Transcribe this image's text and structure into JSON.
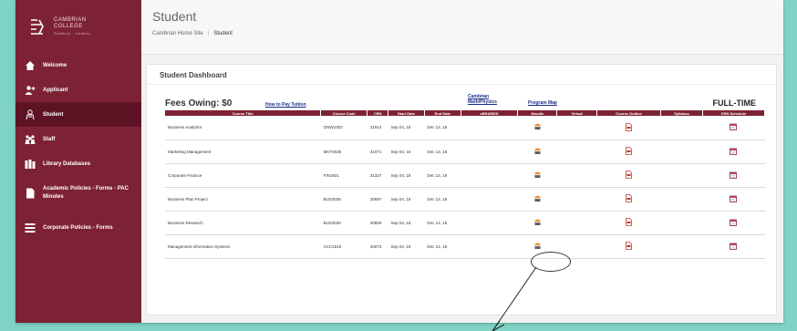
{
  "sidebar": {
    "logo": {
      "line1": "CAMBRIAN",
      "line2": "COLLEGE",
      "sub": "Sudbury · Ontario"
    },
    "items": [
      {
        "label": "Welcome",
        "icon": "home-icon"
      },
      {
        "label": "Applicant",
        "icon": "add-user-icon"
      },
      {
        "label": "Student",
        "icon": "student-icon",
        "active": true
      },
      {
        "label": "Staff",
        "icon": "staff-icon"
      },
      {
        "label": "Library Databases",
        "icon": "books-icon"
      },
      {
        "label": "Academic Policies - Forms - PAC Minutes",
        "icon": "document-icon"
      },
      {
        "label": "Corporate Policies - Forms",
        "icon": "list-icon"
      }
    ]
  },
  "header": {
    "title": "Student",
    "breadcrumb": {
      "home": "Cambrian Home Site",
      "current": "Student"
    }
  },
  "dashboard": {
    "title": "Student Dashboard",
    "fees_owing": "Fees Owing: $0",
    "pay_link": "How to Pay Tuition",
    "cambrian_link": "Cambrian Math/Physics",
    "program_map_link": "Program Map",
    "status": "FULL-TIME",
    "columns": [
      "Course Title",
      "Course Code",
      "CRN",
      "Start Date",
      "End Date",
      "eBRARIES",
      "Moodle",
      "Virtual",
      "Course Outline",
      "Syllabus",
      "CRN Schedule"
    ],
    "rows": [
      {
        "title": "Business Analytics",
        "code": "GNW1003",
        "crn": "31914",
        "start": "Sep 04, 18",
        "end": "Dec 13, 18"
      },
      {
        "title": "Marketing Management",
        "code": "MKT5035",
        "crn": "31071",
        "start": "Sep 04, 18",
        "end": "Dec 13, 18"
      },
      {
        "title": "Corporate Finance",
        "code": "FIN1921",
        "crn": "31327",
        "start": "Sep 04, 18",
        "end": "Dec 13, 18"
      },
      {
        "title": "Business Plan Project",
        "code": "BUS3035",
        "crn": "30697",
        "start": "Sep 04, 18",
        "end": "Dec 13, 18"
      },
      {
        "title": "Business Research",
        "code": "BUS3030",
        "crn": "30859",
        "start": "Sep 04, 18",
        "end": "Dec 13, 18"
      },
      {
        "title": "Management Information Systems",
        "code": "ACC1519",
        "crn": "30673",
        "start": "Sep 04, 18",
        "end": "Dec 13, 18"
      }
    ]
  },
  "colors": {
    "brand": "#7d2235",
    "brand_dark": "#5e1325",
    "background": "#7fd3c5"
  }
}
